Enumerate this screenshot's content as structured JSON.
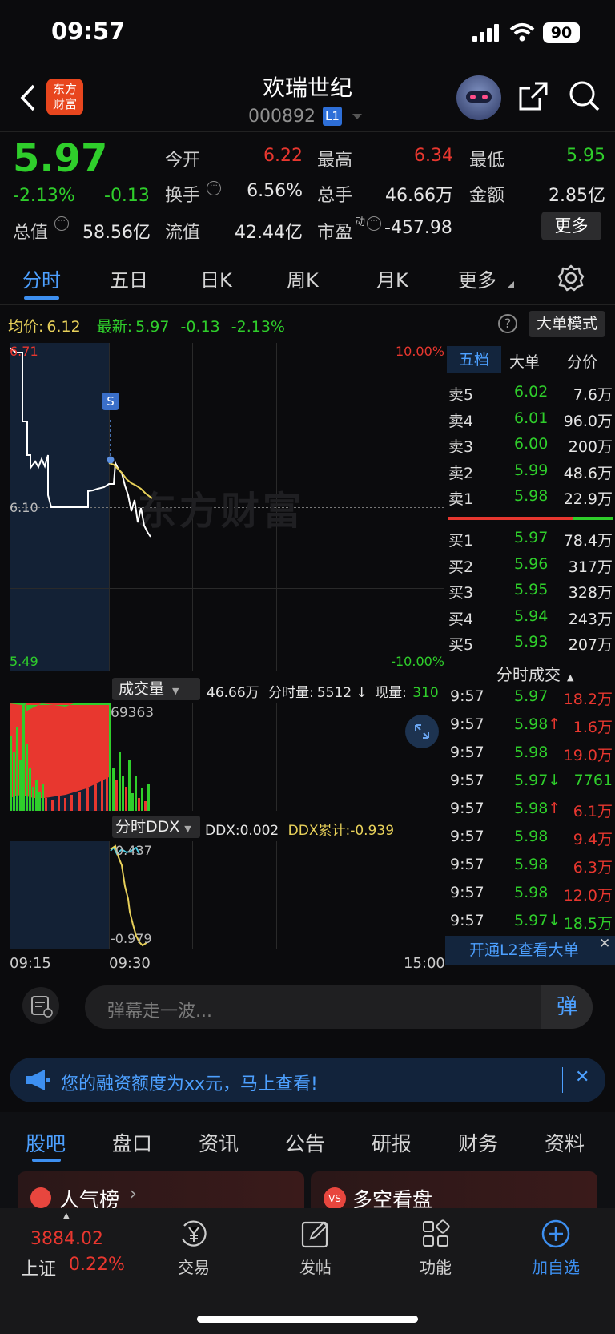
{
  "status": {
    "time": "09:57",
    "battery": "90"
  },
  "header": {
    "logo_text_1": "东方",
    "logo_text_2": "财富",
    "title": "欢瑞世纪",
    "code": "000892",
    "level_badge": "L1"
  },
  "quote": {
    "price": "5.97",
    "change_pct": "-2.13%",
    "change": "-0.13",
    "open_label": "今开",
    "open": "6.22",
    "high_label": "最高",
    "high": "6.34",
    "low_label": "最低",
    "low": "5.95",
    "turnover_label": "换手",
    "turnover": "6.56%",
    "volume_label": "总手",
    "volume": "46.66万",
    "amount_label": "金额",
    "amount": "2.85亿",
    "mktcap_label": "总值",
    "mktcap": "58.56亿",
    "float_label": "流值",
    "float": "42.44亿",
    "pe_label": "市盈",
    "pe_sup": "动",
    "pe": "-457.98",
    "more_button": "更多"
  },
  "period_tabs": [
    "分时",
    "五日",
    "日K",
    "周K",
    "月K",
    "更多"
  ],
  "info_line": {
    "avg_label": "均价:",
    "avg": "6.12",
    "last_label": "最新:",
    "last": "5.97",
    "chg": "-0.13",
    "pct": "-2.13%",
    "big_order_mode": "大单模式"
  },
  "price_chart": {
    "top_price": "6.71",
    "mid_price": "6.10",
    "bottom_price": "5.49",
    "top_pct": "10.00%",
    "bottom_pct": "-10.00%",
    "watermark": "东方财富",
    "marker": "S"
  },
  "volume_panel": {
    "label": "成交量",
    "total": "46.66万",
    "minute_label": "分时量:",
    "minute": "5512",
    "arrow": "↓",
    "now_label": "现量:",
    "now": "310",
    "max": "69363"
  },
  "ddx_panel": {
    "label": "分时DDX",
    "ddx_label": "DDX:",
    "ddx": "0.002",
    "cum_label": "DDX累计:",
    "cum": "-0.939",
    "top_value": "0.437",
    "bottom_value": "-0.979"
  },
  "time_axis": {
    "t1": "09:15",
    "t2": "09:30",
    "t3": "15:00"
  },
  "book_tabs": [
    "五档",
    "大单",
    "分价"
  ],
  "asks": [
    {
      "label": "卖5",
      "price": "6.02",
      "vol": "7.6万"
    },
    {
      "label": "卖4",
      "price": "6.01",
      "vol": "96.0万"
    },
    {
      "label": "卖3",
      "price": "6.00",
      "vol": "200万"
    },
    {
      "label": "卖2",
      "price": "5.99",
      "vol": "48.6万"
    },
    {
      "label": "卖1",
      "price": "5.98",
      "vol": "22.9万"
    }
  ],
  "bids": [
    {
      "label": "买1",
      "price": "5.97",
      "vol": "78.4万"
    },
    {
      "label": "买2",
      "price": "5.96",
      "vol": "317万"
    },
    {
      "label": "买3",
      "price": "5.95",
      "vol": "328万"
    },
    {
      "label": "买4",
      "price": "5.94",
      "vol": "243万"
    },
    {
      "label": "买5",
      "price": "5.93",
      "vol": "207万"
    }
  ],
  "trades_title": "分时成交",
  "trades": [
    {
      "time": "9:57",
      "price": "5.97",
      "arrow": "",
      "vol": "18.2万",
      "color": "#e8372f"
    },
    {
      "time": "9:57",
      "price": "5.98",
      "arrow": "↑",
      "vol": "1.6万",
      "color": "#e8372f"
    },
    {
      "time": "9:57",
      "price": "5.98",
      "arrow": "",
      "vol": "19.0万",
      "color": "#e8372f"
    },
    {
      "time": "9:57",
      "price": "5.97",
      "arrow": "↓",
      "vol": "7761",
      "color": "#2fce2b"
    },
    {
      "time": "9:57",
      "price": "5.98",
      "arrow": "↑",
      "vol": "6.1万",
      "color": "#e8372f"
    },
    {
      "time": "9:57",
      "price": "5.98",
      "arrow": "",
      "vol": "9.4万",
      "color": "#e8372f"
    },
    {
      "time": "9:57",
      "price": "5.98",
      "arrow": "",
      "vol": "6.3万",
      "color": "#e8372f"
    },
    {
      "time": "9:57",
      "price": "5.98",
      "arrow": "",
      "vol": "12.0万",
      "color": "#e8372f"
    },
    {
      "time": "9:57",
      "price": "5.97",
      "arrow": "↓",
      "vol": "18.5万",
      "color": "#2fce2b"
    }
  ],
  "l2_banner": "开通L2查看大单",
  "danmu": {
    "placeholder": "弹幕走一波...",
    "send": "弹"
  },
  "finance_banner": "您的融资额度为xx元，马上查看!",
  "bottom_tabs": [
    "股吧",
    "盘口",
    "资讯",
    "公告",
    "研报",
    "财务",
    "资料"
  ],
  "cards": {
    "popular": "人气榜",
    "longshort": "多空看盘"
  },
  "bottom_nav": {
    "index_value": "3884.02",
    "index_name": "上证",
    "index_pct": "0.22%",
    "trade": "交易",
    "post": "发帖",
    "func": "功能",
    "add": "加自选"
  }
}
